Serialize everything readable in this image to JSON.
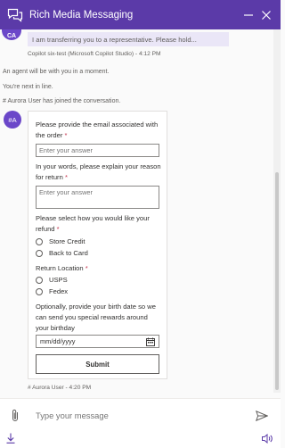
{
  "header": {
    "title": "Rich Media Messaging",
    "chat_icon": "chat-bubbles-icon",
    "minimize_icon": "minimize-icon",
    "close_icon": "close-icon",
    "background_color": "#5b3aa8"
  },
  "transcript": {
    "bot_message": {
      "avatar_initials": "CA",
      "text": "I am transferring you to a representative. Please hold...",
      "meta": "Copilot six-test (Microsoft Copilot Studio) - 4:12 PM"
    },
    "system_messages": [
      "An agent will be with you in a moment.",
      "You're next in line.",
      "# Aurora User has joined the conversation."
    ],
    "agent_avatar": "#A",
    "card_meta": "# Aurora User - 4:20 PM"
  },
  "form": {
    "email_label": "Please provide the email associated with the order",
    "email_placeholder": "Enter your answer",
    "reason_label": "In your words, please explain your reason for return",
    "reason_placeholder": "Enter your answer",
    "refund_label": "Please select how you would like your refund",
    "refund_options": [
      "Store Credit",
      "Back to Card"
    ],
    "location_label": "Return Location",
    "location_options": [
      "USPS",
      "Fedex"
    ],
    "birthday_label": "Optionally, provide your birth date so we can send you special rewards around your birthday",
    "date_placeholder": "mm/dd/yyyy",
    "required_mark": "*",
    "submit_label": "Submit"
  },
  "composer": {
    "placeholder": "Type your message",
    "attach_icon": "paperclip-icon",
    "send_icon": "send-icon"
  },
  "footer": {
    "download_icon": "download-icon",
    "sound_icon": "speaker-icon"
  }
}
